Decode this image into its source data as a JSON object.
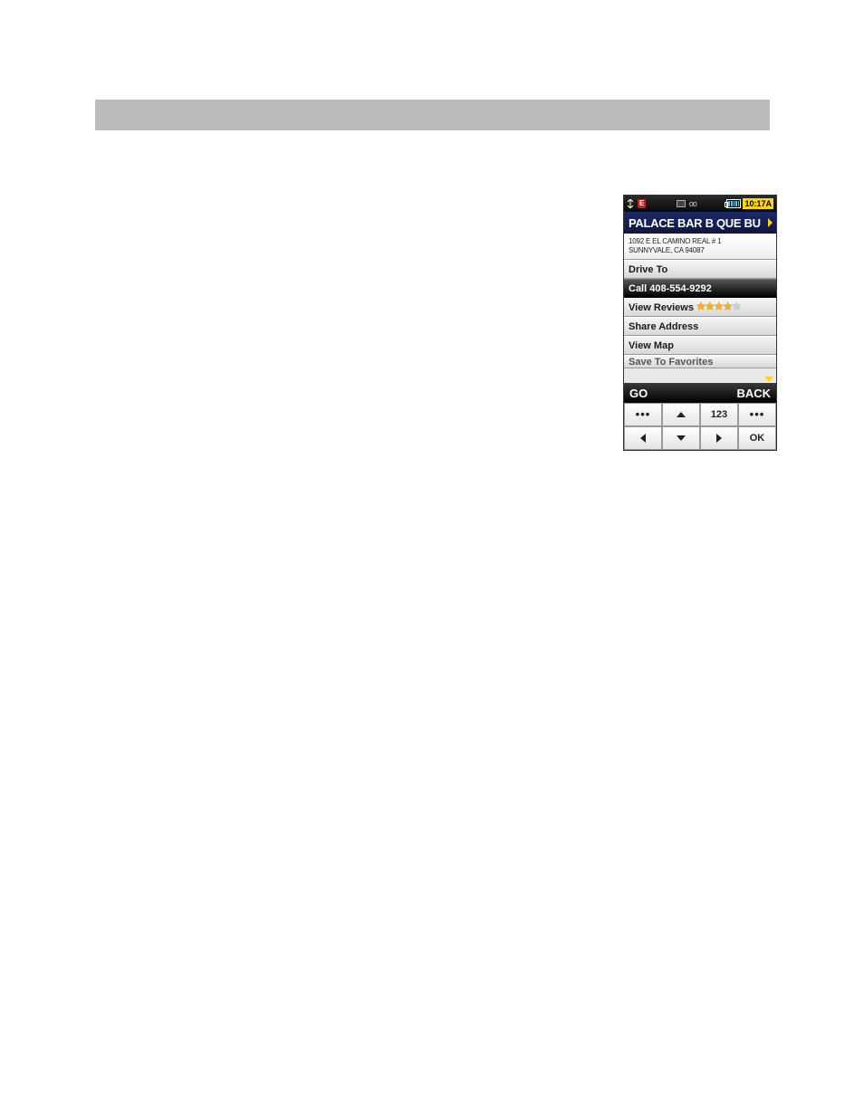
{
  "status": {
    "e_label": "E",
    "loop": "oo",
    "time": "10:17A"
  },
  "title": "PALACE BAR B QUE BU",
  "address": {
    "line1": "1092 E EL CAMINO REAL # 1",
    "line2": "SUNNYVALE, CA 94087"
  },
  "menu": {
    "drive_to": "Drive To",
    "call": "Call 408-554-9292",
    "reviews": "View Reviews",
    "share": "Share Address",
    "map": "View Map",
    "save": "Save To Favorites"
  },
  "rating": {
    "filled": 4,
    "total": 5
  },
  "softkeys": {
    "left": "GO",
    "right": "BACK"
  },
  "keypad": {
    "more1": "•••",
    "num": "123",
    "more2": "•••",
    "ok": "OK"
  }
}
